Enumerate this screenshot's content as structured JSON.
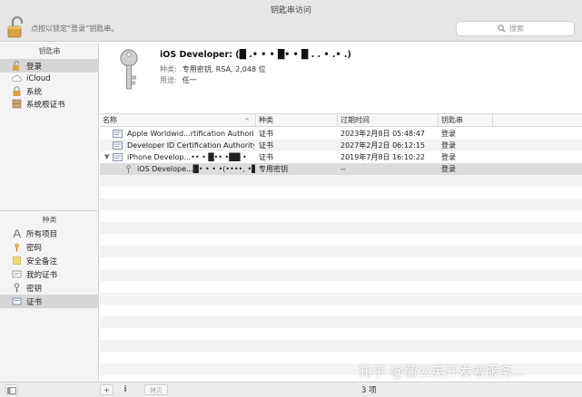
{
  "window": {
    "title": "钥匙串访问"
  },
  "toolbar": {
    "lock_hint": "点按以锁定“登录”钥匙串。",
    "search_placeholder": "搜索"
  },
  "sidebar": {
    "keychains_header": "钥匙串",
    "keychains": [
      {
        "label": "登录",
        "icon": "lock-open-icon",
        "selected": true
      },
      {
        "label": "iCloud",
        "icon": "cloud-icon",
        "selected": false
      },
      {
        "label": "系统",
        "icon": "lock-icon",
        "selected": false
      },
      {
        "label": "系统根证书",
        "icon": "cabinet-icon",
        "selected": false
      }
    ],
    "category_header": "种类",
    "categories": [
      {
        "label": "所有项目",
        "icon": "all-items-icon",
        "selected": false
      },
      {
        "label": "密码",
        "icon": "password-icon",
        "selected": false
      },
      {
        "label": "安全备注",
        "icon": "secure-note-icon",
        "selected": false
      },
      {
        "label": "我的证书",
        "icon": "my-certificates-icon",
        "selected": false
      },
      {
        "label": "密钥",
        "icon": "key-icon",
        "selected": false
      },
      {
        "label": "证书",
        "icon": "certificate-icon",
        "selected": true
      }
    ]
  },
  "detail": {
    "title": "iOS Developer: (█ .• • • █• • █ . . • .• .)",
    "kind_label": "种类:",
    "kind_value": "专用密钥, RSA, 2,048 位",
    "usage_label": "用途:",
    "usage_value": "任一"
  },
  "table": {
    "columns": [
      "名称",
      "种类",
      "过期时间",
      "钥匙串"
    ],
    "rows": [
      {
        "name": "Apple Worldwid...rtification Authority",
        "kind": "证书",
        "expires": "2023年2月8日 05:48:47",
        "keychain": "登录",
        "icon": "certificate-icon",
        "indent": 0,
        "disclosure": ""
      },
      {
        "name": "Developer ID Certification Authority",
        "kind": "证书",
        "expires": "2027年2月2日 06:12:15",
        "keychain": "登录",
        "icon": "certificate-icon",
        "indent": 0,
        "disclosure": ""
      },
      {
        "name": "iPhone Develop...•• • █•• •██ •",
        "kind": "证书",
        "expires": "2019年7月8日 16:10:22",
        "keychain": "登录",
        "icon": "certificate-icon",
        "indent": 0,
        "disclosure": "▼"
      },
      {
        "name": "iOS Develope...█• • • •(••••, •█•)",
        "kind": "专用密钥",
        "expires": "--",
        "keychain": "登录",
        "icon": "key-icon",
        "indent": 1,
        "disclosure": ""
      }
    ],
    "sort_indicator": "^"
  },
  "bottom": {
    "add_label": "+",
    "info_label": "i",
    "copy_label": "拷贝",
    "status": "3 项"
  },
  "watermark": "知乎 @蒲公英开发者服务...",
  "colors": {
    "selection": "#d6d6d6",
    "titlebar": "#e7e6e7",
    "sidebar": "#f4f4f4"
  }
}
